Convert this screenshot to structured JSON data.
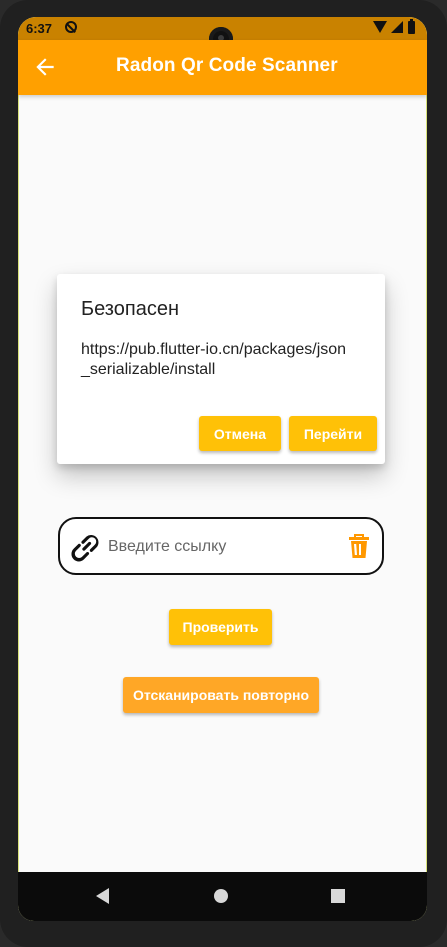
{
  "status_bar": {
    "time": "6:37",
    "icons": [
      "cast-icon",
      "wifi-icon",
      "signal-icon",
      "battery-icon"
    ]
  },
  "app_bar": {
    "title": "Radon Qr Code Scanner",
    "back_icon": "arrow-left-icon",
    "background_color": "#ffa000"
  },
  "dialog": {
    "title": "Безопасен",
    "content": "https://pub.flutter-io.cn/packages/json_serializable/install",
    "actions": {
      "cancel_label": "Отмена",
      "go_label": "Перейти"
    }
  },
  "url_field": {
    "placeholder": "Введите ссылку",
    "value": "",
    "left_icon": "link-icon",
    "right_icon": "trash-icon"
  },
  "buttons": {
    "check_label": "Проверить",
    "rescan_label": "Отсканировать повторно"
  },
  "colors": {
    "primary": "#ffa000",
    "button": "#ffc107",
    "rescan_button": "#ffa726",
    "delete_icon": "#ff9800"
  },
  "nav_bar": {
    "icons": [
      "nav-back-icon",
      "nav-home-icon",
      "nav-overview-icon"
    ]
  }
}
